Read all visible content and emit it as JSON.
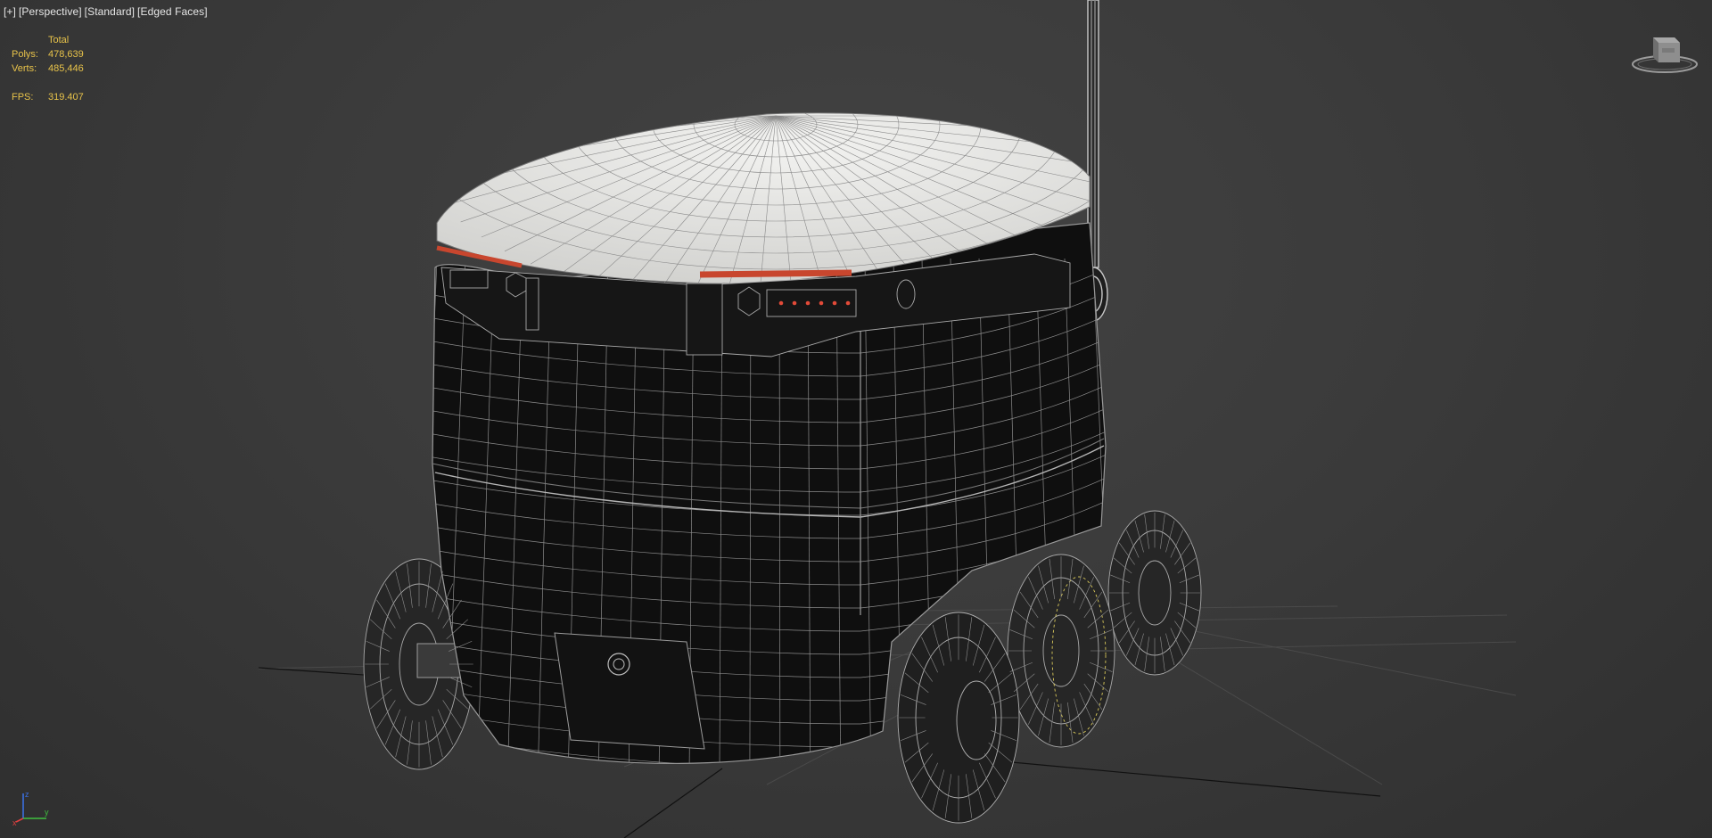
{
  "viewport": {
    "label_parts": [
      "[+]",
      "[Perspective]",
      "[Standard]",
      "[Edged Faces]"
    ],
    "background_color": "#3b3b3b",
    "wire_color": "#bdbdbd",
    "accent_red": "#c8462e"
  },
  "stats": {
    "header": "Total",
    "polys_label": "Polys:",
    "polys_value": "478,639",
    "verts_label": "Verts:",
    "verts_value": "485,446",
    "fps_label": "FPS:",
    "fps_value": "319.407",
    "text_color": "#e8c34a"
  },
  "viewcube": {
    "icon": "viewcube-icon"
  },
  "axis": {
    "x_label": "x",
    "y_label": "y",
    "z_label": "z"
  }
}
